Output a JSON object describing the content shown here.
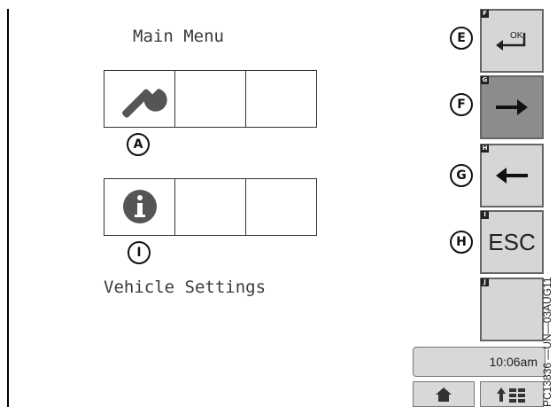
{
  "main_menu": {
    "title": "Main Menu",
    "section_label": "Vehicle Settings"
  },
  "callouts": {
    "a": "A",
    "i": "I",
    "e": "E",
    "f": "F",
    "g": "G",
    "h": "H"
  },
  "softkeys": {
    "e_letter": "F",
    "f_letter": "G",
    "g_letter": "H",
    "h_letter": "I",
    "j_letter": "J",
    "ok_label": "OK",
    "esc_label": "ESC"
  },
  "status": {
    "time": "10:06am"
  },
  "figure_id": "PC13836 —UN—03AUG11",
  "icons": {
    "grid1_cell1": "wrench-icon",
    "grid2_cell1": "info-icon",
    "key_e": "enter-ok-icon",
    "key_f": "arrow-right-icon",
    "key_g": "arrow-left-icon",
    "home": "home-icon",
    "menu": "up-arrow-menu-icon"
  }
}
